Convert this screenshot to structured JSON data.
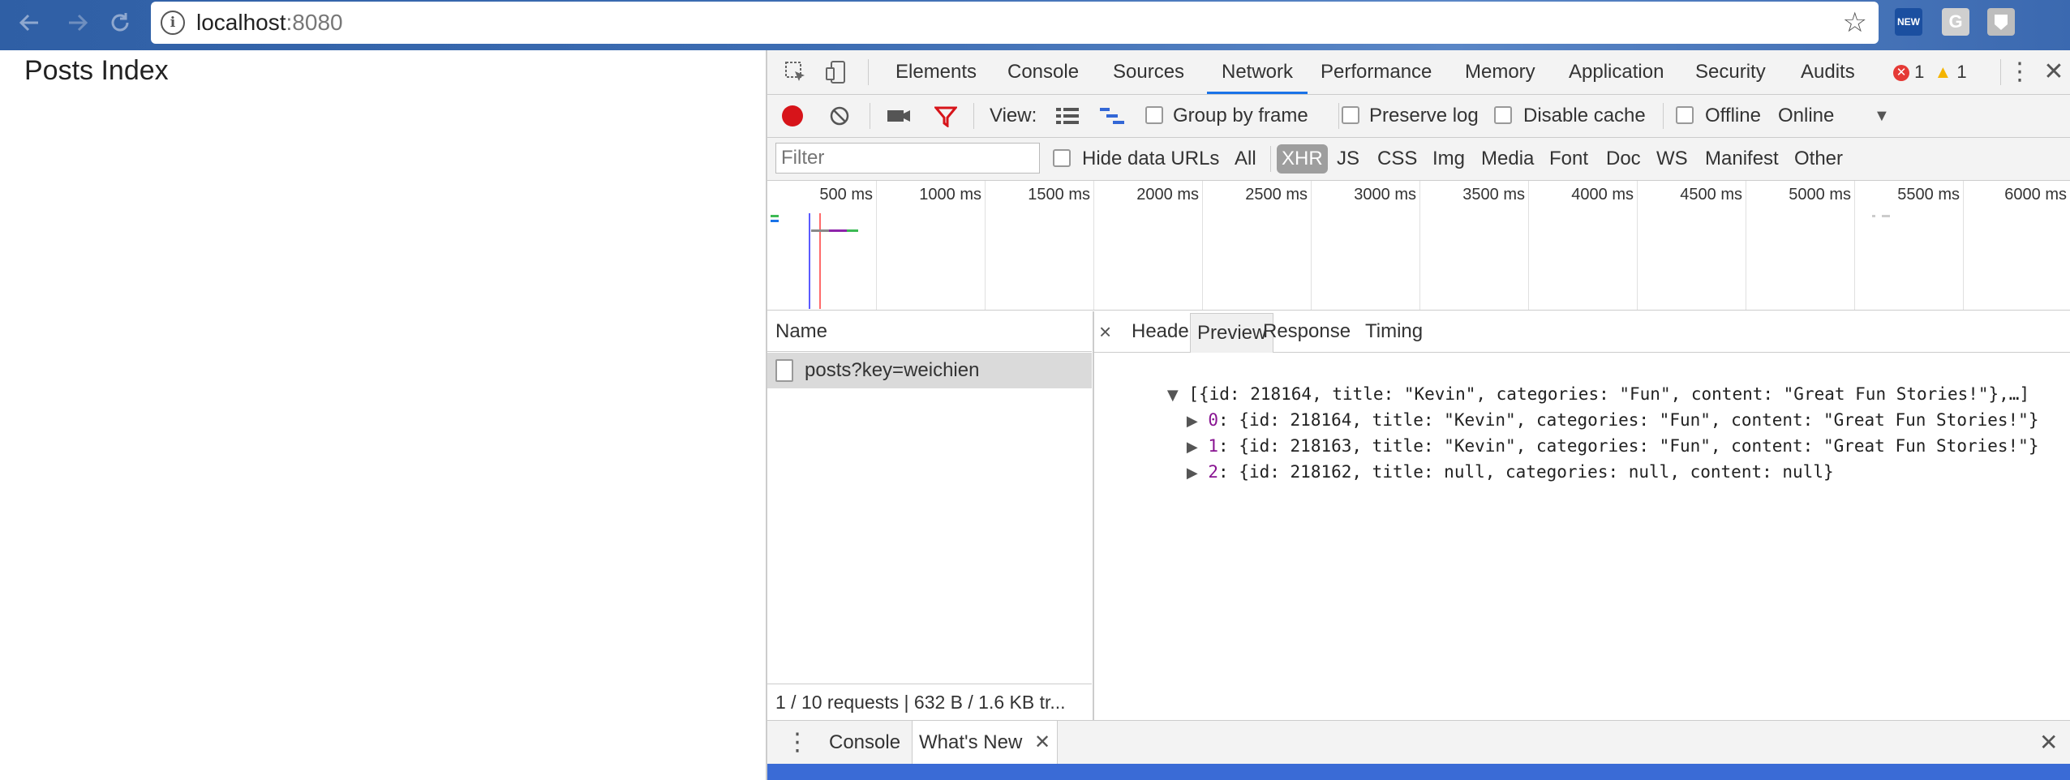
{
  "browser": {
    "url_host": "localhost",
    "url_port": ":8080",
    "back_icon": "arrow-left-icon",
    "forward_icon": "arrow-right-icon",
    "reload_icon": "reload-icon",
    "extensions": [
      "NEW",
      "G",
      ""
    ]
  },
  "page": {
    "title": "Posts Index"
  },
  "devtools": {
    "tabs": [
      "Elements",
      "Console",
      "Sources",
      "Network",
      "Performance",
      "Memory",
      "Application",
      "Security",
      "Audits"
    ],
    "active_tab": "Network",
    "errors_count": "1",
    "warnings_count": "1",
    "toolbar": {
      "view_label": "View:",
      "group_by_frame": "Group by frame",
      "preserve_log": "Preserve log",
      "disable_cache": "Disable cache",
      "offline": "Offline",
      "throttle": "Online"
    },
    "filter_bar": {
      "placeholder": "Filter",
      "hide_data_urls": "Hide data URLs",
      "types": [
        "All",
        "XHR",
        "JS",
        "CSS",
        "Img",
        "Media",
        "Font",
        "Doc",
        "WS",
        "Manifest",
        "Other"
      ],
      "active_type": "XHR"
    },
    "overview_ticks": [
      "500 ms",
      "1000 ms",
      "1500 ms",
      "2000 ms",
      "2500 ms",
      "3000 ms",
      "3500 ms",
      "4000 ms",
      "4500 ms",
      "5000 ms",
      "5500 ms",
      "6000 ms"
    ],
    "requests": {
      "column_header": "Name",
      "rows": [
        "posts?key=weichien"
      ],
      "status": "1 / 10 requests | 632 B / 1.6 KB tr..."
    },
    "detail": {
      "tabs": [
        "Headers",
        "Preview",
        "Response",
        "Timing"
      ],
      "active_tab": "Preview",
      "preview_root": "[{id: 218164, title: \"Kevin\", categories: \"Fun\", content: \"Great Fun Stories!\"},…]",
      "preview_items": [
        {
          "index": "0",
          "text": "{id: 218164, title: \"Kevin\", categories: \"Fun\", content: \"Great Fun Stories!\"}"
        },
        {
          "index": "1",
          "text": "{id: 218163, title: \"Kevin\", categories: \"Fun\", content: \"Great Fun Stories!\"}"
        },
        {
          "index": "2",
          "text": "{id: 218162, title: null, categories: null, content: null}"
        }
      ]
    },
    "drawer": {
      "tabs": [
        "Console",
        "What's New"
      ],
      "active_tab": "What's New"
    }
  }
}
